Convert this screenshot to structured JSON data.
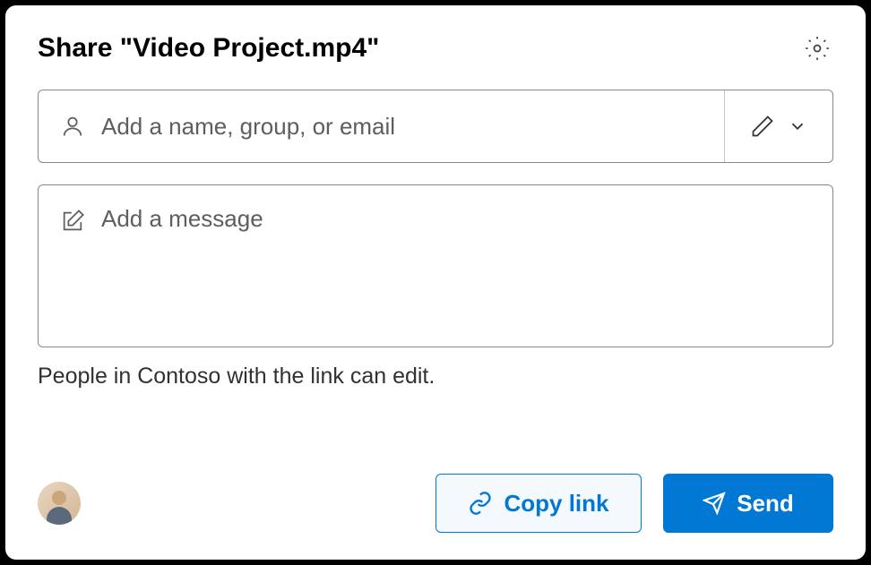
{
  "header": {
    "title": "Share \"Video Project.mp4\""
  },
  "name_field": {
    "placeholder": "Add a name, group, or email"
  },
  "message_field": {
    "placeholder": "Add a message"
  },
  "permission_info": "People in Contoso with the link can edit.",
  "buttons": {
    "copy_link": "Copy link",
    "send": "Send"
  }
}
